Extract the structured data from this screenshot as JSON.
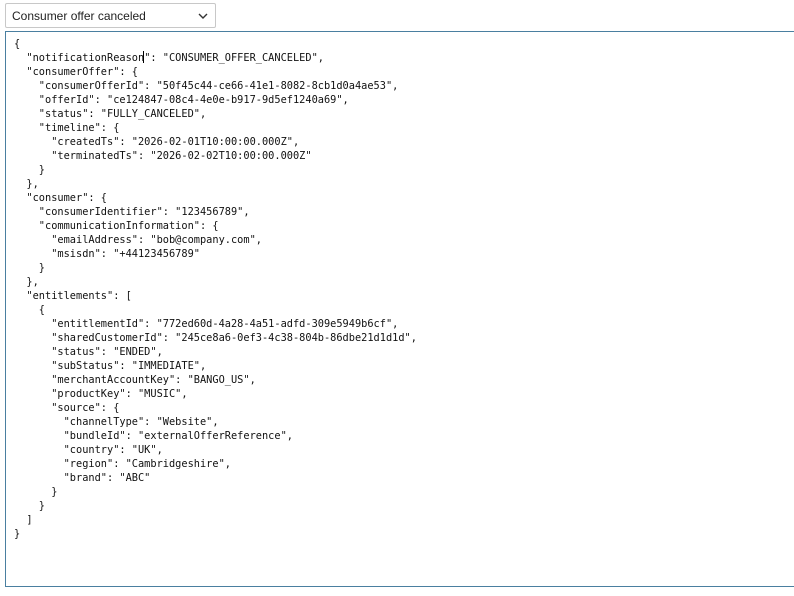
{
  "select": {
    "value": "Consumer offer canceled",
    "icon": "chevron-down-icon"
  },
  "editor": {
    "lines": [
      "{",
      "  \"notificationReason\": \"CONSUMER_OFFER_CANCELED\",",
      "  \"consumerOffer\": {",
      "    \"consumerOfferId\": \"50f45c44-ce66-41e1-8082-8cb1d0a4ae53\",",
      "    \"offerId\": \"ce124847-08c4-4e0e-b917-9d5ef1240a69\",",
      "    \"status\": \"FULLY_CANCELED\",",
      "    \"timeline\": {",
      "      \"createdTs\": \"2026-02-01T10:00:00.000Z\",",
      "      \"terminatedTs\": \"2026-02-02T10:00:00.000Z\"",
      "    }",
      "  },",
      "  \"consumer\": {",
      "    \"consumerIdentifier\": \"123456789\",",
      "    \"communicationInformation\": {",
      "      \"emailAddress\": \"bob@company.com\",",
      "      \"msisdn\": \"+44123456789\"",
      "    }",
      "  },",
      "  \"entitlements\": [",
      "    {",
      "      \"entitlementId\": \"772ed60d-4a28-4a51-adfd-309e5949b6cf\",",
      "      \"sharedCustomerId\": \"245ce8a6-0ef3-4c38-804b-86dbe21d1d1d\",",
      "      \"status\": \"ENDED\",",
      "      \"subStatus\": \"IMMEDIATE\",",
      "      \"merchantAccountKey\": \"BANGO_US\",",
      "      \"productKey\": \"MUSIC\",",
      "      \"source\": {",
      "        \"channelType\": \"Website\",",
      "        \"bundleId\": \"externalOfferReference\",",
      "        \"country\": \"UK\",",
      "        \"region\": \"Cambridgeshire\",",
      "        \"brand\": \"ABC\"",
      "      }",
      "    }",
      "  ]",
      "}"
    ]
  }
}
